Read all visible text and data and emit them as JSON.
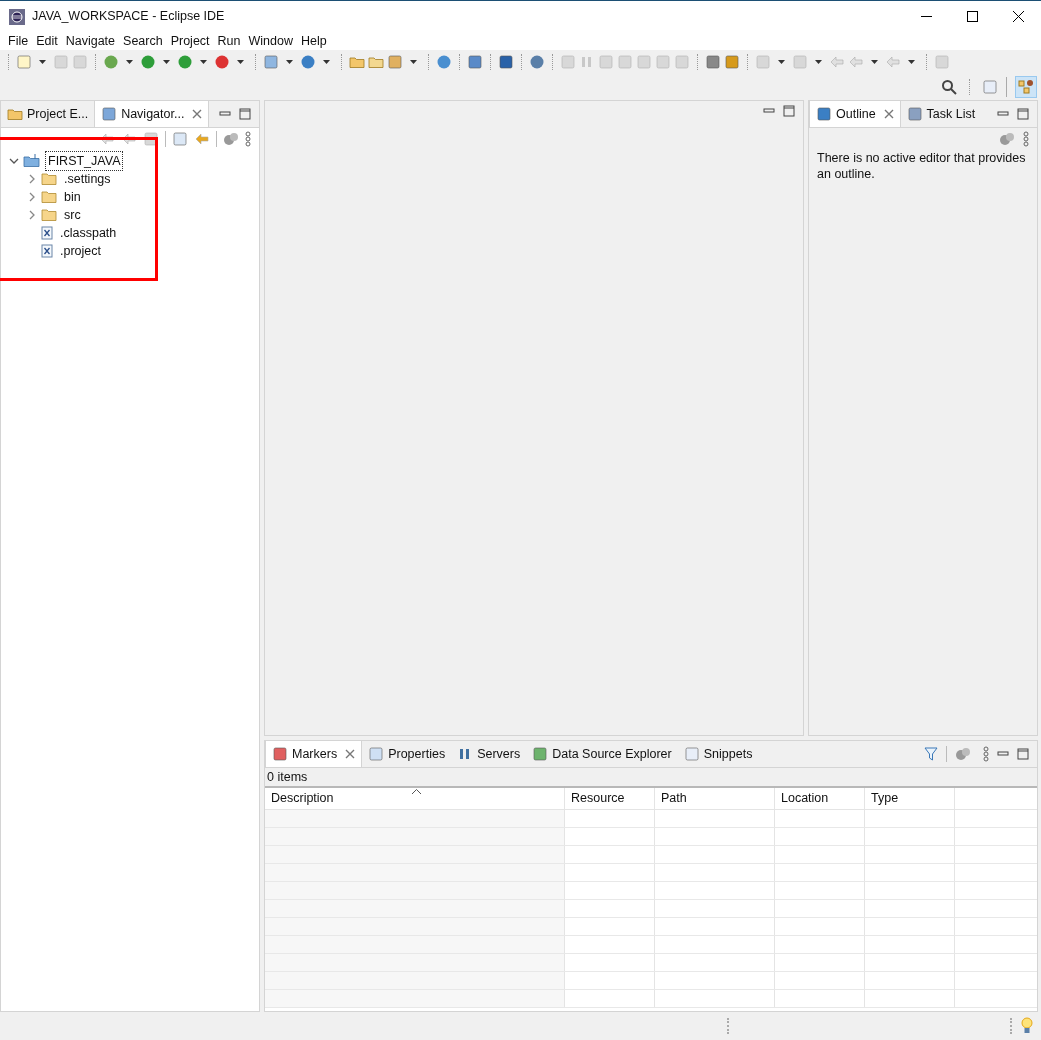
{
  "window": {
    "title": "JAVA_WORKSPACE - Eclipse IDE"
  },
  "menu": [
    "File",
    "Edit",
    "Navigate",
    "Search",
    "Project",
    "Run",
    "Window",
    "Help"
  ],
  "left_panel": {
    "tabs": [
      {
        "label": "Project E...",
        "selected": false
      },
      {
        "label": "Navigator...",
        "selected": true
      }
    ],
    "tree": [
      {
        "label": "FIRST_JAVA",
        "kind": "project",
        "expanded": true,
        "selected": true,
        "children": [
          {
            "label": ".settings",
            "kind": "folder",
            "expanded": false,
            "selected": false
          },
          {
            "label": "bin",
            "kind": "folder",
            "expanded": false,
            "selected": false
          },
          {
            "label": "src",
            "kind": "folder",
            "expanded": false,
            "selected": false
          },
          {
            "label": ".classpath",
            "kind": "file",
            "selected": false
          },
          {
            "label": ".project",
            "kind": "file",
            "selected": false
          }
        ]
      }
    ]
  },
  "outline_panel": {
    "tabs": [
      {
        "label": "Outline",
        "selected": true
      },
      {
        "label": "Task List",
        "selected": false
      }
    ],
    "message": "There is no active editor that provides an outline."
  },
  "bottom_panel": {
    "tabs": [
      {
        "label": "Markers",
        "selected": true
      },
      {
        "label": "Properties",
        "selected": false
      },
      {
        "label": "Servers",
        "selected": false
      },
      {
        "label": "Data Source Explorer",
        "selected": false
      },
      {
        "label": "Snippets",
        "selected": false
      }
    ],
    "count": "0 items",
    "table": {
      "columns": [
        "Description",
        "Resource",
        "Path",
        "Location",
        "Type"
      ]
    }
  }
}
